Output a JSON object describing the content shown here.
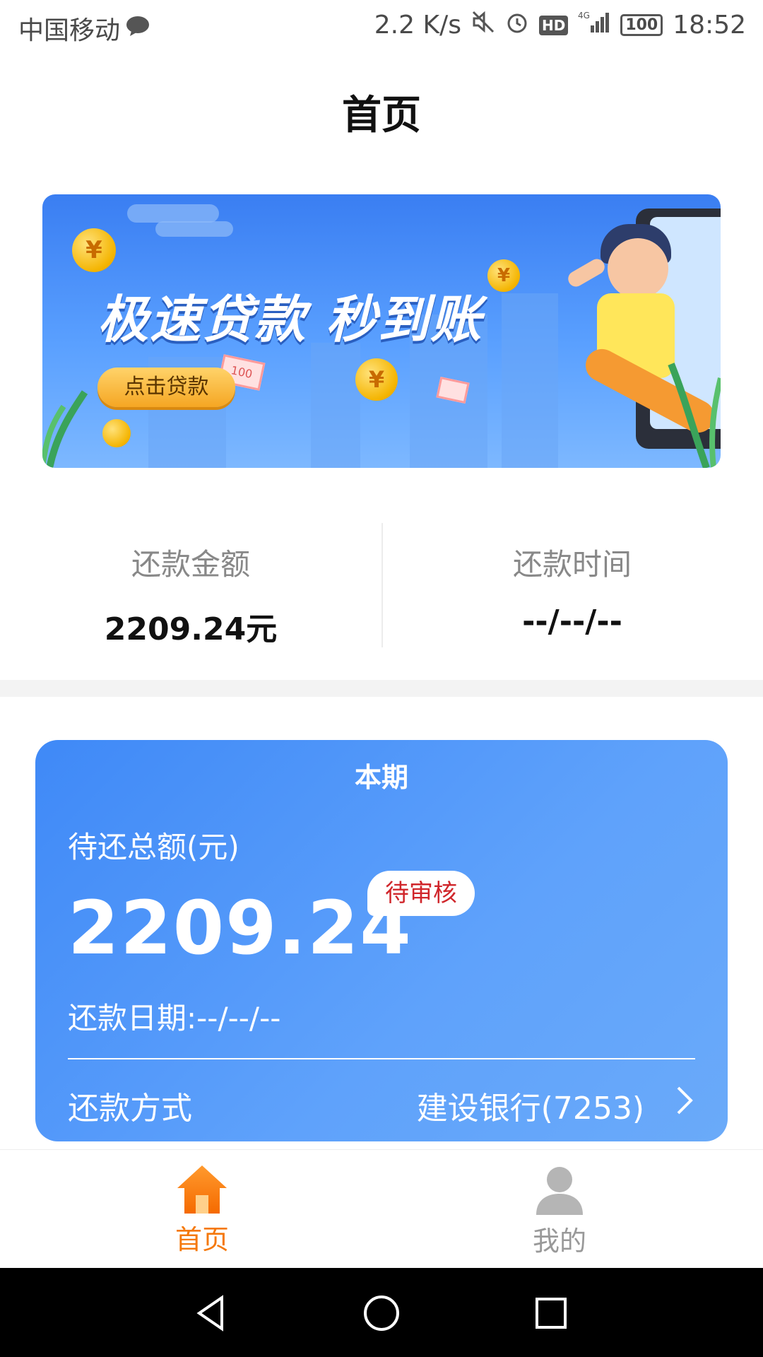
{
  "status_bar": {
    "carrier": "中国移动",
    "speed": "2.2 K/s",
    "hd": "HD",
    "network": "4G",
    "battery": "100",
    "time": "18:52"
  },
  "page": {
    "title": "首页"
  },
  "banner": {
    "headline": "极速贷款 秒到账",
    "button_label": "点击贷款",
    "coin_symbol": "¥",
    "bill_label": "100"
  },
  "summary": {
    "amount_label": "还款金额",
    "amount_value": "2209.24元",
    "time_label": "还款时间",
    "time_value": "--/--/--"
  },
  "card": {
    "title": "本期",
    "pending_label": "待还总额(元)",
    "amount": "2209.24",
    "status_badge": "待审核",
    "due_date": "还款日期:--/--/--",
    "method_label": "还款方式",
    "method_value": "建设银行(7253)"
  },
  "tabs": [
    {
      "label": "首页",
      "active": true,
      "icon": "home-icon"
    },
    {
      "label": "我的",
      "active": false,
      "icon": "user-icon"
    }
  ],
  "colors": {
    "accent_orange": "#f5780a",
    "card_blue": "#4a90f5",
    "badge_red": "#d0262b"
  }
}
